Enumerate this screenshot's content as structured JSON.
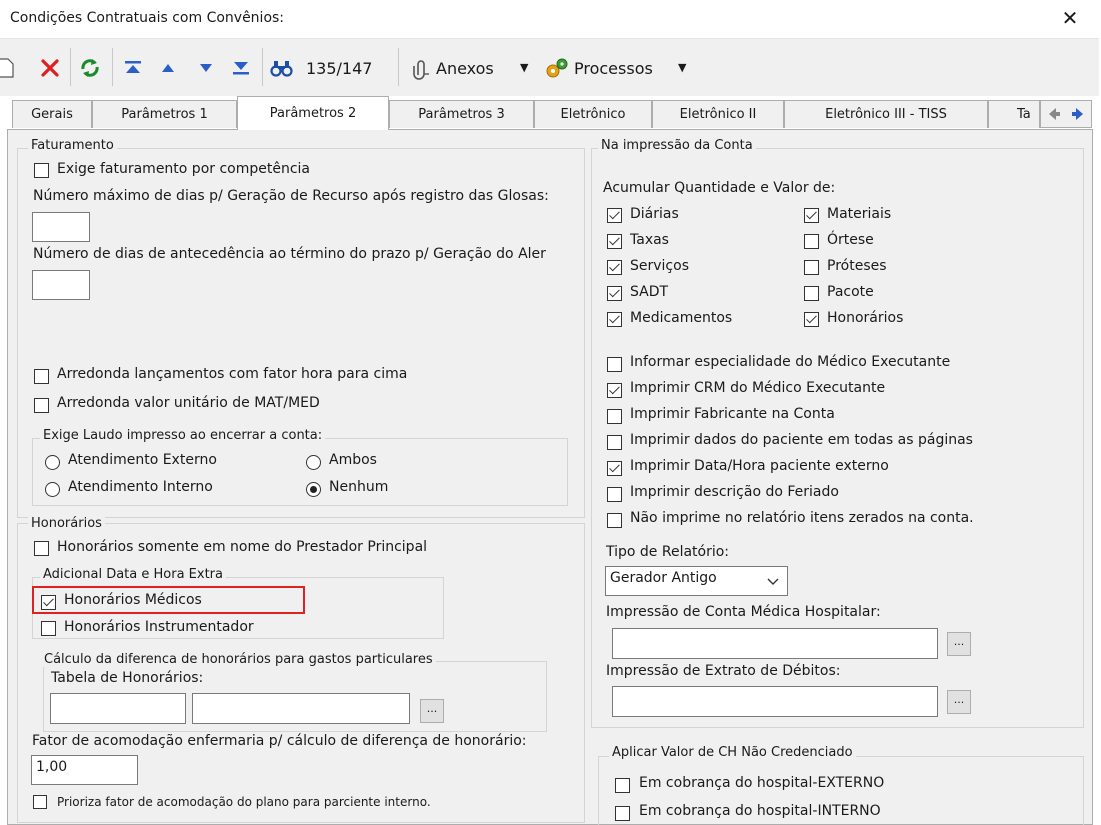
{
  "window": {
    "title": "Condições Contratuais com Convênios:"
  },
  "toolbar": {
    "record_counter": "135/147",
    "anexos_label": "Anexos",
    "processos_label": "Processos"
  },
  "tabs": [
    "Gerais",
    "Parâmetros 1",
    "Parâmetros 2",
    "Parâmetros 3",
    "Eletrônico",
    "Eletrônico II",
    "Eletrônico III - TISS",
    "Ta"
  ],
  "faturamento": {
    "title": "Faturamento",
    "exige_competencia": "Exige faturamento por competência",
    "max_dias_recurso": "Número máximo de dias p/ Geração de Recurso após registro das Glosas:",
    "dias_antecedencia": "Número de dias de antecedência ao término do prazo p/ Geração do Aler",
    "arredonda_fator": "Arredonda lançamentos com fator hora para cima",
    "arredonda_matmed": "Arredonda valor unitário de MAT/MED",
    "laudo": {
      "title": "Exige Laudo impresso ao encerrar a conta:",
      "externo": "Atendimento Externo",
      "ambos": "Ambos",
      "interno": "Atendimento Interno",
      "nenhum": "Nenhum"
    }
  },
  "honorarios": {
    "title": "Honorários",
    "somente_prestador": "Honorários somente em nome do Prestador Principal",
    "adicional": {
      "title": "Adicional Data e Hora Extra",
      "medicos": "Honorários Médicos",
      "instrumentador": "Honorários Instrumentador"
    },
    "calculo": {
      "title": "Cálculo da diferenca de honorários para gastos particulares",
      "tabela_label": "Tabela de Honorários:",
      "browse": "..."
    },
    "fator_label": "Fator de acomodação enfermaria p/ cálculo de diferença de honorário:",
    "fator_value": "1,00",
    "prioriza": "Prioriza fator de acomodação do plano para parciente interno."
  },
  "impressao": {
    "title": "Na impressão da Conta",
    "acumular": "Acumular Quantidade e Valor de:",
    "items_left": [
      "Diárias",
      "Taxas",
      "Serviços",
      "SADT",
      "Medicamentos"
    ],
    "items_right": [
      "Materiais",
      "Órtese",
      "Próteses",
      "Pacote",
      "Honorários"
    ],
    "options": [
      "Informar especialidade do Médico Executante",
      "Imprimir CRM do Médico Executante",
      "Imprimir Fabricante na Conta",
      "Imprimir dados do paciente em todas as páginas",
      "Imprimir Data/Hora paciente externo",
      "Imprimir descrição do Feriado",
      "Não imprime no relatório itens zerados na conta."
    ],
    "tipo_relatorio_label": "Tipo de Relatório:",
    "tipo_relatorio_value": "Gerador Antigo",
    "conta_medica_label": "Impressão de Conta Médica Hospitalar:",
    "extrato_label": "Impressão de Extrato de Débitos:",
    "browse": "..."
  },
  "ch": {
    "title": "Aplicar Valor de CH Não Credenciado",
    "externo": "Em cobrança do hospital-EXTERNO",
    "interno": "Em cobrança do hospital-INTERNO"
  }
}
